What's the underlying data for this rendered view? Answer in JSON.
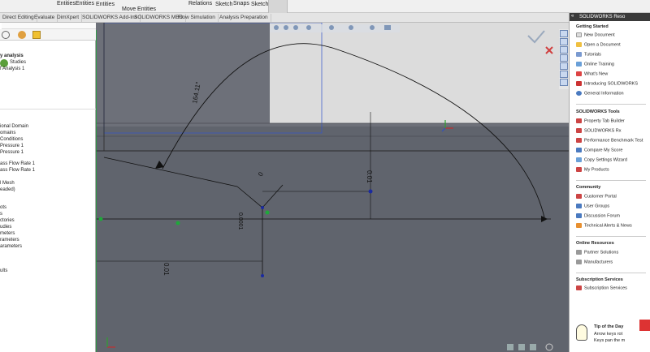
{
  "ribbon": {
    "items": [
      "Entities",
      "Entities",
      "Entities",
      "Move Entities",
      "Relations",
      "Sketch",
      "Snaps",
      "Sketch"
    ]
  },
  "tabs": [
    "Direct Editing",
    "Evaluate",
    "DimXpert",
    "SOLIDWORKS Add-Ins",
    "SOLIDWORKS MBD",
    "Flow Simulation",
    "Analysis Preparation"
  ],
  "left_tree": {
    "top": [
      "y analysis",
      "Studies",
      "f Analysis 1"
    ],
    "items": [
      "ional Domain",
      "omains",
      "Conditions",
      "Pressure 1",
      "Pressure 1",
      "ass Flow Rate 1",
      "ass Flow Rate 1",
      "l Mesh",
      "eaded)",
      "ots",
      "s",
      "ctories",
      "udies",
      "meters",
      "rameters",
      "arameters",
      "ults"
    ]
  },
  "viewport": {
    "dimensions": [
      "164.11°",
      "0",
      "0.01",
      "0.0001",
      "0.01"
    ]
  },
  "right_panel": {
    "title": "SOLIDWORKS Reso",
    "getting_started": {
      "heading": "Getting Started",
      "items": [
        "New Document",
        "Open a Document",
        "Tutorials",
        "Online Training",
        "What's New",
        "Introducing SOLIDWORKS",
        "General Information"
      ]
    },
    "tools": {
      "heading": "SOLIDWORKS Tools",
      "items": [
        "Property Tab Builder",
        "SOLIDWORKS Rx",
        "Performance Benchmark Test",
        "Compare My Score",
        "Copy Settings Wizard",
        "My Products"
      ]
    },
    "community": {
      "heading": "Community",
      "items": [
        "Customer Portal",
        "User Groups",
        "Discussion Forum",
        "Technical Alerts & News"
      ]
    },
    "online": {
      "heading": "Online Resources",
      "items": [
        "Partner Solutions",
        "Manufacturers"
      ]
    },
    "subscription": {
      "heading": "Subscription Services",
      "items": [
        "Subscription Services"
      ]
    },
    "tip": {
      "heading": "Tip of the Day",
      "line1": "Arrow keys rot",
      "line2": "Keys pan the m"
    }
  }
}
